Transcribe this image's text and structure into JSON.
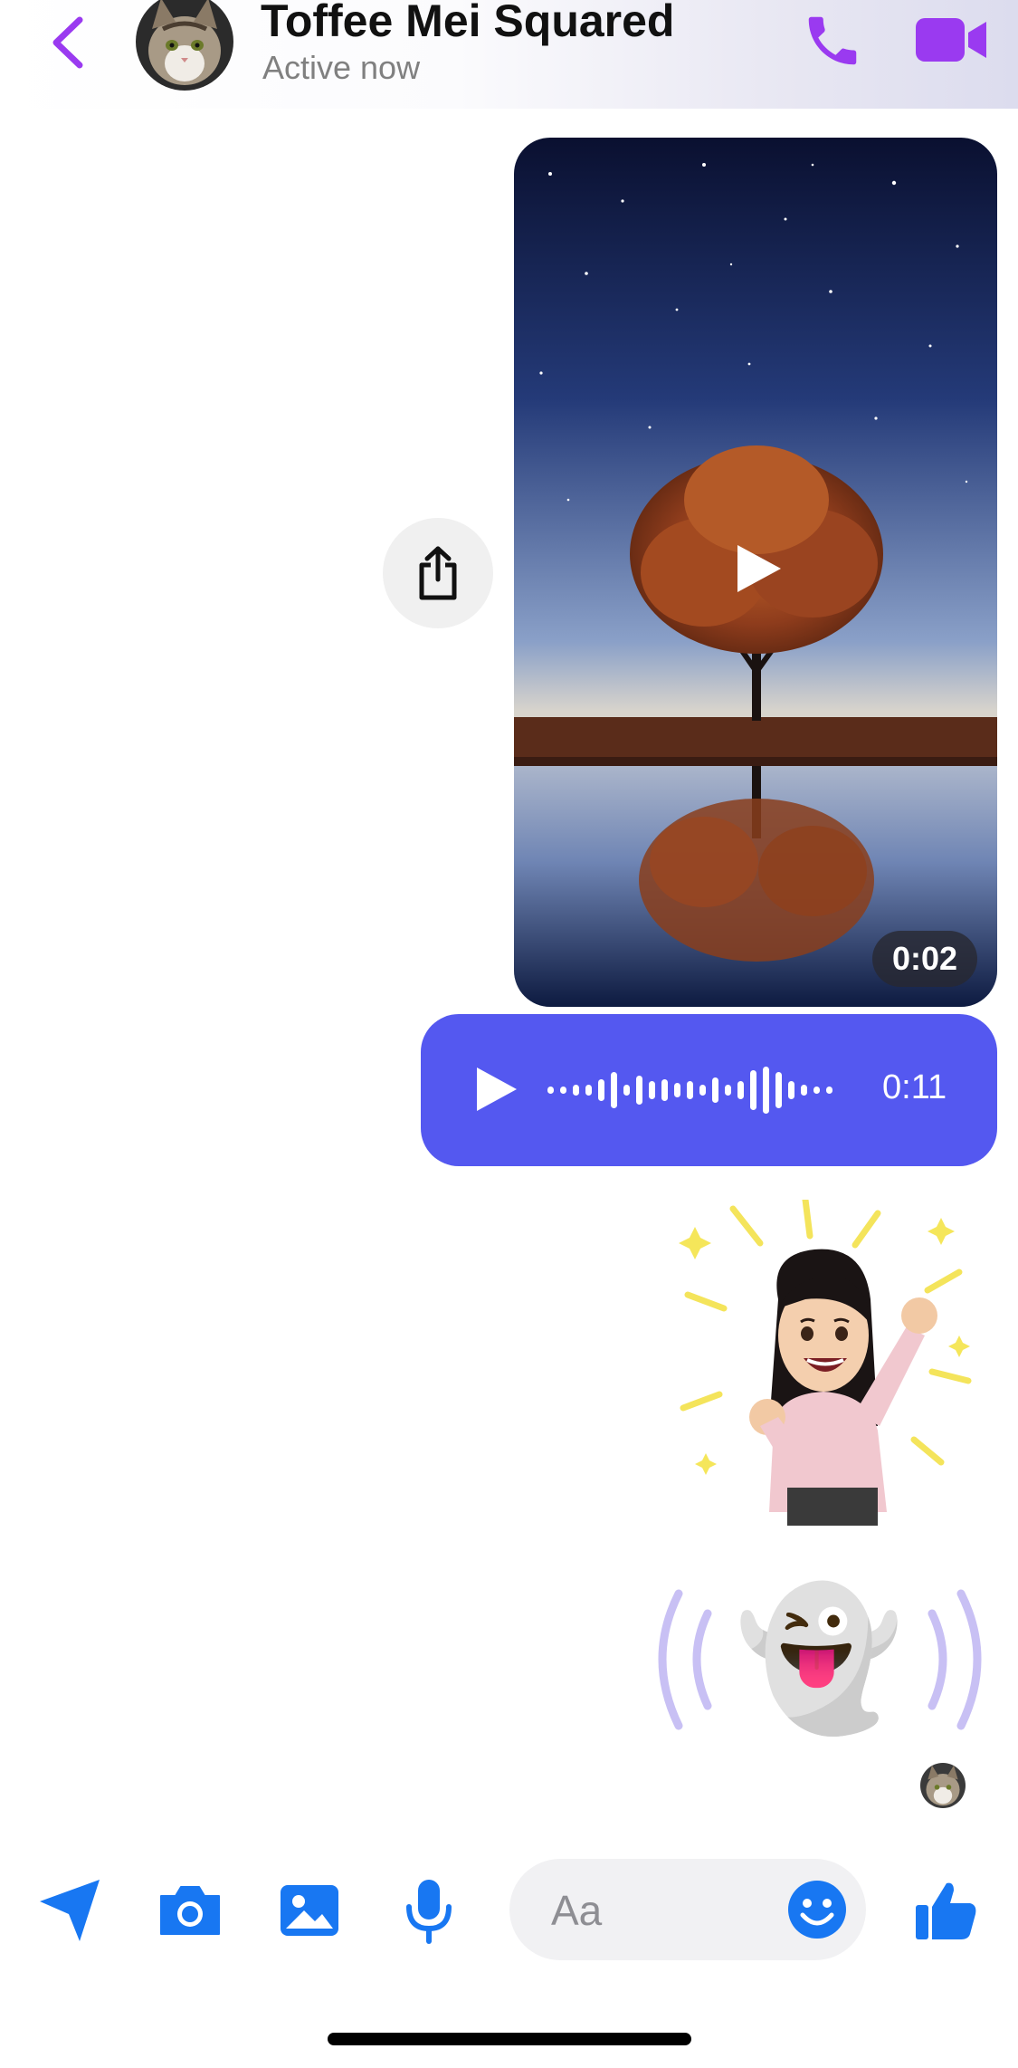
{
  "header": {
    "contact_name": "Toffee Mei Squared",
    "status": "Active now",
    "accent_color": "#9a3af0"
  },
  "messages": {
    "video": {
      "duration": "0:02"
    },
    "audio": {
      "duration": "0:11",
      "bubble_color": "#5458f0"
    },
    "sticker": {
      "description_icon": "celebrating-avatar-sticker"
    },
    "emoji": {
      "glyph": "👻",
      "icon": "ghost-emoji"
    }
  },
  "composer": {
    "placeholder": "Aa",
    "accent_color": "#1877f2"
  }
}
